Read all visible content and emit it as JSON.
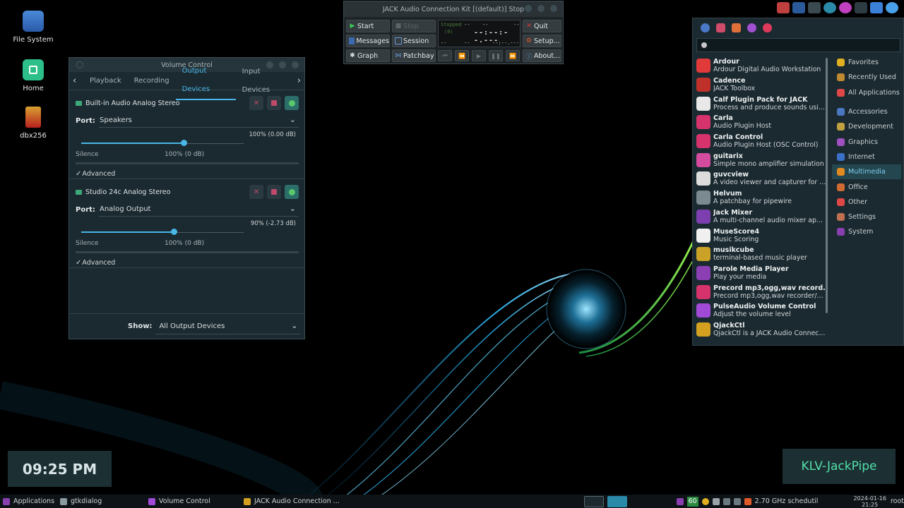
{
  "desktop": {
    "icons": [
      {
        "label": "File System"
      },
      {
        "label": "Home"
      },
      {
        "label": "dbx256"
      }
    ]
  },
  "volume_control": {
    "title": "Volume Control",
    "tabs": [
      "Playback",
      "Recording",
      "Output Devices",
      "Input Devices"
    ],
    "active_tab": "Output Devices",
    "devices": [
      {
        "name": "Built-in Audio Analog Stereo",
        "port_label": "Port:",
        "port": "Speakers",
        "readout": "100% (0.00 dB)",
        "level": 1.0,
        "mark_silence": "Silence",
        "mark_100": "100% (0 dB)",
        "advanced": "Advanced"
      },
      {
        "name": "Studio 24c Analog Stereo",
        "port_label": "Port:",
        "port": "Analog Output",
        "readout": "90% (-2.73 dB)",
        "level": 0.9,
        "mark_silence": "Silence",
        "mark_100": "100% (0 dB)",
        "advanced": "Advanced"
      }
    ],
    "show_label": "Show:",
    "show_value": "All Output Devices"
  },
  "jack": {
    "title": "JACK Audio Connection Kit [(default)] Stop",
    "buttons": {
      "start": "Start",
      "stop": "Stop",
      "quit": "Quit",
      "messages": "Messages",
      "session": "Session",
      "setup": "Setup...",
      "graph": "Graph",
      "patchbay": "Patchbay",
      "about": "About..."
    },
    "display": {
      "status": "Stopped",
      "count": "(0)",
      "time": "--:--:--.---",
      "dash1": "--",
      "dash2": "--",
      "dash3": "--",
      "dash4": "--",
      "dash5": "--",
      "dash6": "--:--.---"
    }
  },
  "app_menu": {
    "search_placeholder": "",
    "apps": [
      {
        "name": "Ardour",
        "desc": "Ardour Digital Audio Workstation",
        "color": "#e03a3a"
      },
      {
        "name": "Cadence",
        "desc": "JACK Toolbox",
        "color": "#c0302a"
      },
      {
        "name": "Calf Plugin Pack for JACK",
        "desc": "Process and produce sounds using ...",
        "color": "#e8e8e8"
      },
      {
        "name": "Carla",
        "desc": "Audio Plugin Host",
        "color": "#d6336c"
      },
      {
        "name": "Carla Control",
        "desc": "Audio Plugin Host (OSC Control)",
        "color": "#d6336c"
      },
      {
        "name": "guitarix",
        "desc": "Simple mono amplifier simulation",
        "color": "#d44ca0"
      },
      {
        "name": "guvcview",
        "desc": "A video viewer and capturer for the...",
        "color": "#dcdcdc"
      },
      {
        "name": "Helvum",
        "desc": "A patchbay for pipewire",
        "color": "#7a8a90"
      },
      {
        "name": "Jack Mixer",
        "desc": "A multi-channel audio mixer applic...",
        "color": "#7d3fb0"
      },
      {
        "name": "MuseScore4",
        "desc": "Music Scoring",
        "color": "#f0f0f0"
      },
      {
        "name": "musikcube",
        "desc": "terminal-based music player",
        "color": "#c9a227"
      },
      {
        "name": "Parole Media Player",
        "desc": "Play your media",
        "color": "#8b3fb3"
      },
      {
        "name": "Precord mp3,ogg,wav record...",
        "desc": "Precord mp3,ogg,wav recorder/pla...",
        "color": "#d6336c"
      },
      {
        "name": "PulseAudio Volume Control",
        "desc": "Adjust the volume level",
        "color": "#a24ad8"
      },
      {
        "name": "QjackCtl",
        "desc": "QjackCtl is a JACK Audio Connectio...",
        "color": "#d4a020"
      }
    ],
    "categories": [
      {
        "label": "Favorites",
        "color": "#e0b020"
      },
      {
        "label": "Recently Used",
        "color": "#c08a30"
      },
      {
        "label": "All Applications",
        "color": "#e04848"
      },
      {
        "label": "Accessories",
        "color": "#4a78c0"
      },
      {
        "label": "Development",
        "color": "#c0a040"
      },
      {
        "label": "Graphics",
        "color": "#a050c0"
      },
      {
        "label": "Internet",
        "color": "#3a70c8"
      },
      {
        "label": "Multimedia",
        "color": "#e08a20"
      },
      {
        "label": "Office",
        "color": "#d06a30"
      },
      {
        "label": "Other",
        "color": "#e04848"
      },
      {
        "label": "Settings",
        "color": "#c07050"
      },
      {
        "label": "System",
        "color": "#8a3fb0"
      }
    ],
    "active_category": "Multimedia"
  },
  "widgets": {
    "clock": "09:25 PM",
    "brand": "KLV-JackPipe"
  },
  "taskbar": {
    "applications": "Applications",
    "tasks": [
      "gtkdialog",
      "Volume Control",
      "JACK Audio Connection ..."
    ],
    "badge": "60",
    "cpu": "2.70 GHz schedutil",
    "date": "2024-01-16",
    "time": "21:25",
    "user": "root"
  }
}
